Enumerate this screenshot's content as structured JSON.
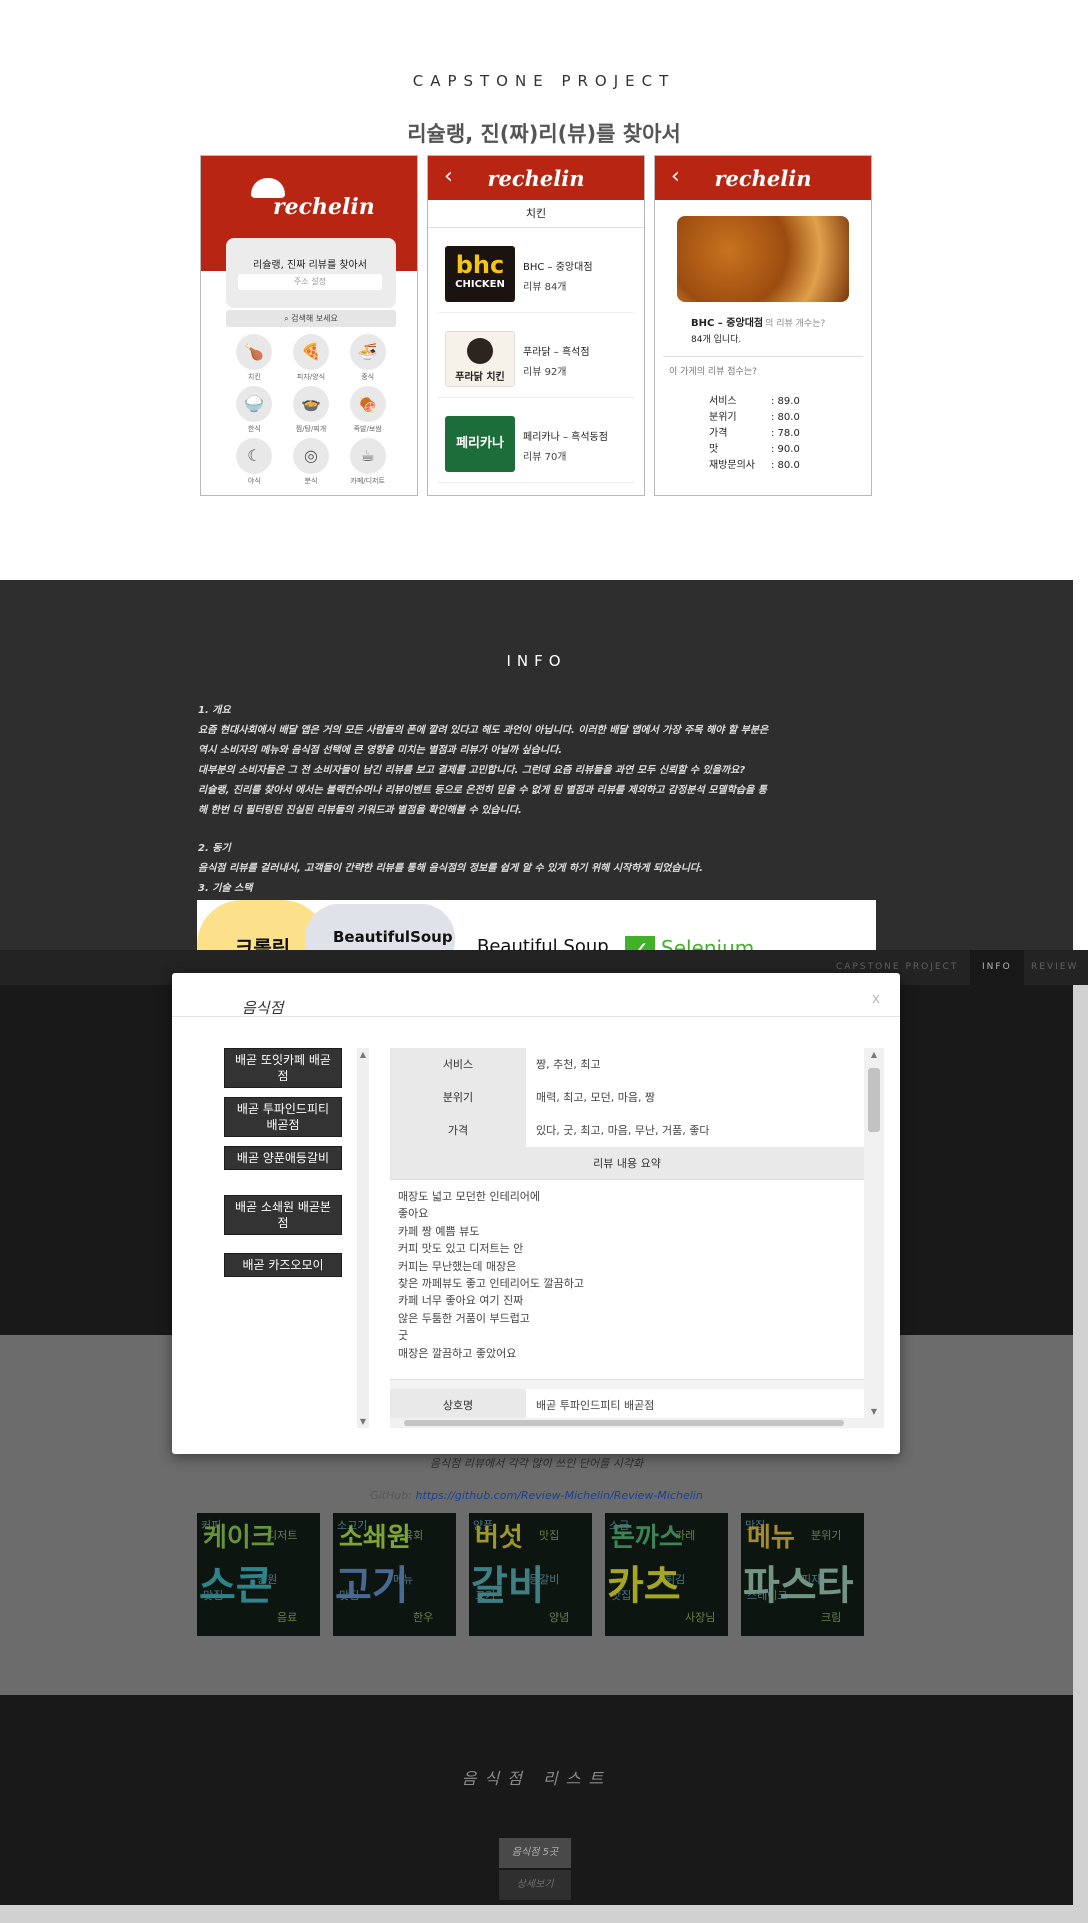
{
  "header": {
    "title": "CAPSTONE PROJECT",
    "subtitle": "리슐랭, 진(짜)리(뷰)를 찾아서"
  },
  "phone1": {
    "brand": "rechelin",
    "card_title": "리슐랭, 진짜 리뷰를 찾아서",
    "address_placeholder": "주소 설정",
    "search_label": "검색해 보세요",
    "categories": [
      {
        "label": "치킨",
        "icon": "drumstick-icon",
        "glyph": "🍗"
      },
      {
        "label": "피자/양식",
        "icon": "pizza-icon",
        "glyph": "🍕"
      },
      {
        "label": "중식",
        "icon": "noodle-bowl-icon",
        "glyph": "🍜"
      },
      {
        "label": "한식",
        "icon": "rice-bowl-icon",
        "glyph": "🍚"
      },
      {
        "label": "찜/탕/찌개",
        "icon": "pot-icon",
        "glyph": "🍲"
      },
      {
        "label": "족발/보쌈",
        "icon": "meat-icon",
        "glyph": "🍖"
      },
      {
        "label": "야식",
        "icon": "moon-icon",
        "glyph": "☾"
      },
      {
        "label": "분식",
        "icon": "plate-icon",
        "glyph": "◎"
      },
      {
        "label": "카페/디저트",
        "icon": "cup-icon",
        "glyph": "☕"
      }
    ]
  },
  "phone2": {
    "brand": "rechelin",
    "category": "치킨",
    "stores": [
      {
        "name": "BHC – 중앙대점",
        "reviews": "리뷰 84개",
        "logo_text": "bhc",
        "logo_sub": "CHICKEN"
      },
      {
        "name": "푸라닭 – 흑석점",
        "reviews": "리뷰 92개",
        "logo_text": "푸라닭 치킨"
      },
      {
        "name": "페리카나 – 흑석동점",
        "reviews": "리뷰 70개",
        "logo_text": "페리카나"
      }
    ]
  },
  "phone3": {
    "brand": "rechelin",
    "store_name": "BHC – 중앙대점",
    "review_question": "의 리뷰 개수는?",
    "review_count": "84개 입니다.",
    "score_question": "이 가게의 리뷰 점수는?",
    "scores": [
      {
        "label": "서비스",
        "value": ": 89.0"
      },
      {
        "label": "분위기",
        "value": ": 80.0"
      },
      {
        "label": "가격",
        "value": ": 78.0"
      },
      {
        "label": "맛",
        "value": ": 90.0"
      },
      {
        "label": "재방문의사",
        "value": ": 80.0"
      }
    ]
  },
  "info": {
    "title": "INFO",
    "lines": [
      "1. 개요",
      "요즘 현대사회에서 배달 앱은 거의 모든 사람들의 폰에 깔려 있다고 해도 과언이 아닙니다. 이러한 배달 앱에서 가장 주목 해야 할 부분은",
      "역시 소비자의 메뉴와 음식점 선택에 큰 영향을 미치는 별점과 리뷰가 아닐까 싶습니다.",
      "대부분의 소비자들은 그 전 소비자들이 남긴 리뷰를 보고 결제를 고민합니다. 그런데 요즘 리뷰들을 과연 모두 신뢰할 수 있을까요?",
      "리슐랭, 진리를 찾아서 에서는 블랙컨슈머나 리뷰이벤트 등으로 온전히 믿을 수 없게 된 별점과 리뷰를 제외하고 감정분석 모델학습을 통",
      "해 한번 더 필터링된 진실된 리뷰들의 키워드과 별점을 확인해볼 수 있습니다.",
      "2. 동기",
      "음식점 리뷰를 걸러내서, 고객들이 간략한 리뷰를 통해 음식점의 정보를 쉽게 알 수 있게 하기 위해 시작하게 되었습니다.",
      "3. 기술 스택"
    ],
    "tech": {
      "crawling": "크롤링",
      "bs_label": "BeautifulSoup",
      "bs_logo": "Beautiful Soup",
      "selenium": "Selenium"
    }
  },
  "nav": {
    "items": [
      "CAPSTONE PROJECT",
      "INFO",
      "REVIEW"
    ],
    "active": "INFO"
  },
  "modal": {
    "title": "음식점",
    "close": "x",
    "stores": [
      "배곧 또잇카페 배곧점",
      "배곧 투파인드피티 배곧점",
      "배곧 양푼애등갈비",
      "배곧 소쇄원 배곧본점",
      "배곧 카즈오모이"
    ],
    "rows": [
      {
        "key": "서비스",
        "value": "짱, 추천, 최고"
      },
      {
        "key": "분위기",
        "value": "매력, 최고, 모던, 마음, 짱"
      },
      {
        "key": "가격",
        "value": "있다, 굿, 최고, 마음, 무난, 거품, 좋다"
      }
    ],
    "summary_header": "리뷰 내용 요약",
    "summary_lines": [
      "매장도 넓고 모던한 인테리어에",
      "좋아요",
      "카페 짱 예쁨 뷰도",
      "커피 맛도 있고 디저트는 안",
      "커피는 무난했는데 매장은",
      "찾은 까페뷰도 좋고 인테리어도 깔끔하고",
      "카페 너무 좋아요 여기 진짜",
      "않은 두툼한 거품이 부드럽고",
      "굿",
      "매장은 깔끔하고 좋았어요"
    ],
    "name_row": {
      "key": "상호명",
      "value": "배곧 투파인드피티 배곧점"
    }
  },
  "review": {
    "desc": "음식점 리뷰에서 각각 많이 쓰인 단어를 시각화",
    "link_prefix": "GitHub:",
    "link": "https://github.com/Review-Michelin/Review-Michelin",
    "wordclouds": [
      {
        "main": "스콘",
        "second": "케이크",
        "small": [
          "커피",
          "디저트",
          "맛집",
          "음료",
          "공원"
        ],
        "color": "#3aa0a8",
        "color2": "#7db44a"
      },
      {
        "main": "고기",
        "second": "소쇄원",
        "small": [
          "소고기",
          "육회",
          "맛집",
          "한우",
          "메뉴"
        ],
        "color": "#5a7fb3",
        "color2": "#9ac83c"
      },
      {
        "main": "갈비",
        "second": "버섯",
        "small": [
          "양푼",
          "맛집",
          "고기",
          "양념",
          "등갈비"
        ],
        "color": "#4e9aa0",
        "color2": "#c2b83a"
      },
      {
        "main": "카츠",
        "second": "돈까스",
        "small": [
          "소금",
          "카레",
          "맛집",
          "사장님",
          "튀김"
        ],
        "color": "#c9cb2d",
        "color2": "#4aa06a"
      },
      {
        "main": "파스타",
        "second": "메뉴",
        "small": [
          "맛집",
          "분위기",
          "스테이크",
          "크림",
          "피자"
        ],
        "color": "#8cb6a0",
        "color2": "#caa93a"
      }
    ]
  },
  "list": {
    "title": "음식점 리스트",
    "count_button": "음식점 5곳",
    "detail_button": "상세보기"
  }
}
